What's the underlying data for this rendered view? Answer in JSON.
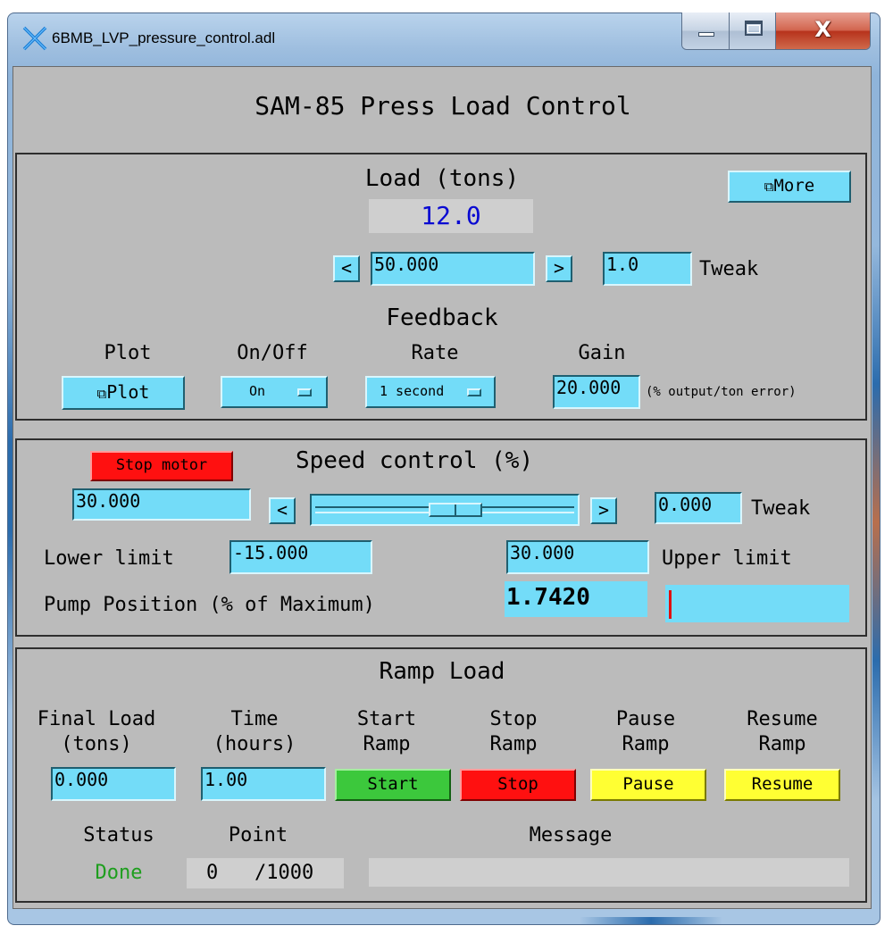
{
  "window": {
    "title": "6BMB_LVP_pressure_control.adl",
    "icons": {
      "app": "x-window-icon",
      "minimize": "minimize-icon",
      "maximize": "maximize-icon",
      "close": "close-icon"
    },
    "close_glyph": "X"
  },
  "header": {
    "title": "SAM-85 Press Load Control"
  },
  "load": {
    "heading": "Load (tons)",
    "readback": "12.0",
    "readback_color": "#0a0ad2",
    "more_label": "More",
    "decrement_label": "<",
    "setpoint": "50.000",
    "increment_label": ">",
    "tweak_value": "1.0",
    "tweak_label": "Tweak"
  },
  "feedback": {
    "heading": "Feedback",
    "plot_label": "Plot",
    "plot_button": "Plot",
    "onoff_label": "On/Off",
    "onoff_value": "On",
    "rate_label": "Rate",
    "rate_value": "1 second",
    "gain_label": "Gain",
    "gain_value": "20.000",
    "gain_units": "(% output/ton error)"
  },
  "speed": {
    "stop_motor_label": "Stop motor",
    "heading": "Speed control (%)",
    "value": "30.000",
    "decrement_label": "<",
    "increment_label": ">",
    "slider_fraction": 0.55,
    "tweak_value": "0.000",
    "tweak_label": "Tweak",
    "lower_limit_label": "Lower limit",
    "lower_limit_value": "-15.000",
    "upper_limit_value": "30.000",
    "upper_limit_label": "Upper limit",
    "pump_position_label": "Pump Position (% of Maximum)",
    "pump_position_value": "1.7420",
    "pump_bar_fraction": 0.017
  },
  "ramp": {
    "heading": "Ramp Load",
    "final_load_label_1": "Final Load",
    "final_load_label_2": "(tons)",
    "time_label_1": "Time",
    "time_label_2": "(hours)",
    "start_label_1": "Start",
    "start_label_2": "Ramp",
    "stop_label_1": "Stop",
    "stop_label_2": "Ramp",
    "pause_label_1": "Pause",
    "pause_label_2": "Ramp",
    "resume_label_1": "Resume",
    "resume_label_2": "Ramp",
    "final_load_value": "0.000",
    "time_value": "1.00",
    "start_button": "Start",
    "stop_button": "Stop",
    "pause_button": "Pause",
    "resume_button": "Resume",
    "status_label": "Status",
    "point_label": "Point",
    "message_label": "Message",
    "status_value": "Done",
    "status_color": "#1e9e1e",
    "point_value": "0",
    "point_total": "/1000",
    "message_value": ""
  },
  "colors": {
    "background": "#bbbbbb",
    "field": "#73dcf8",
    "start": "#3cc83c",
    "stop": "#ff1010",
    "pause": "#ffff33",
    "pump_marker": "#e01010"
  }
}
